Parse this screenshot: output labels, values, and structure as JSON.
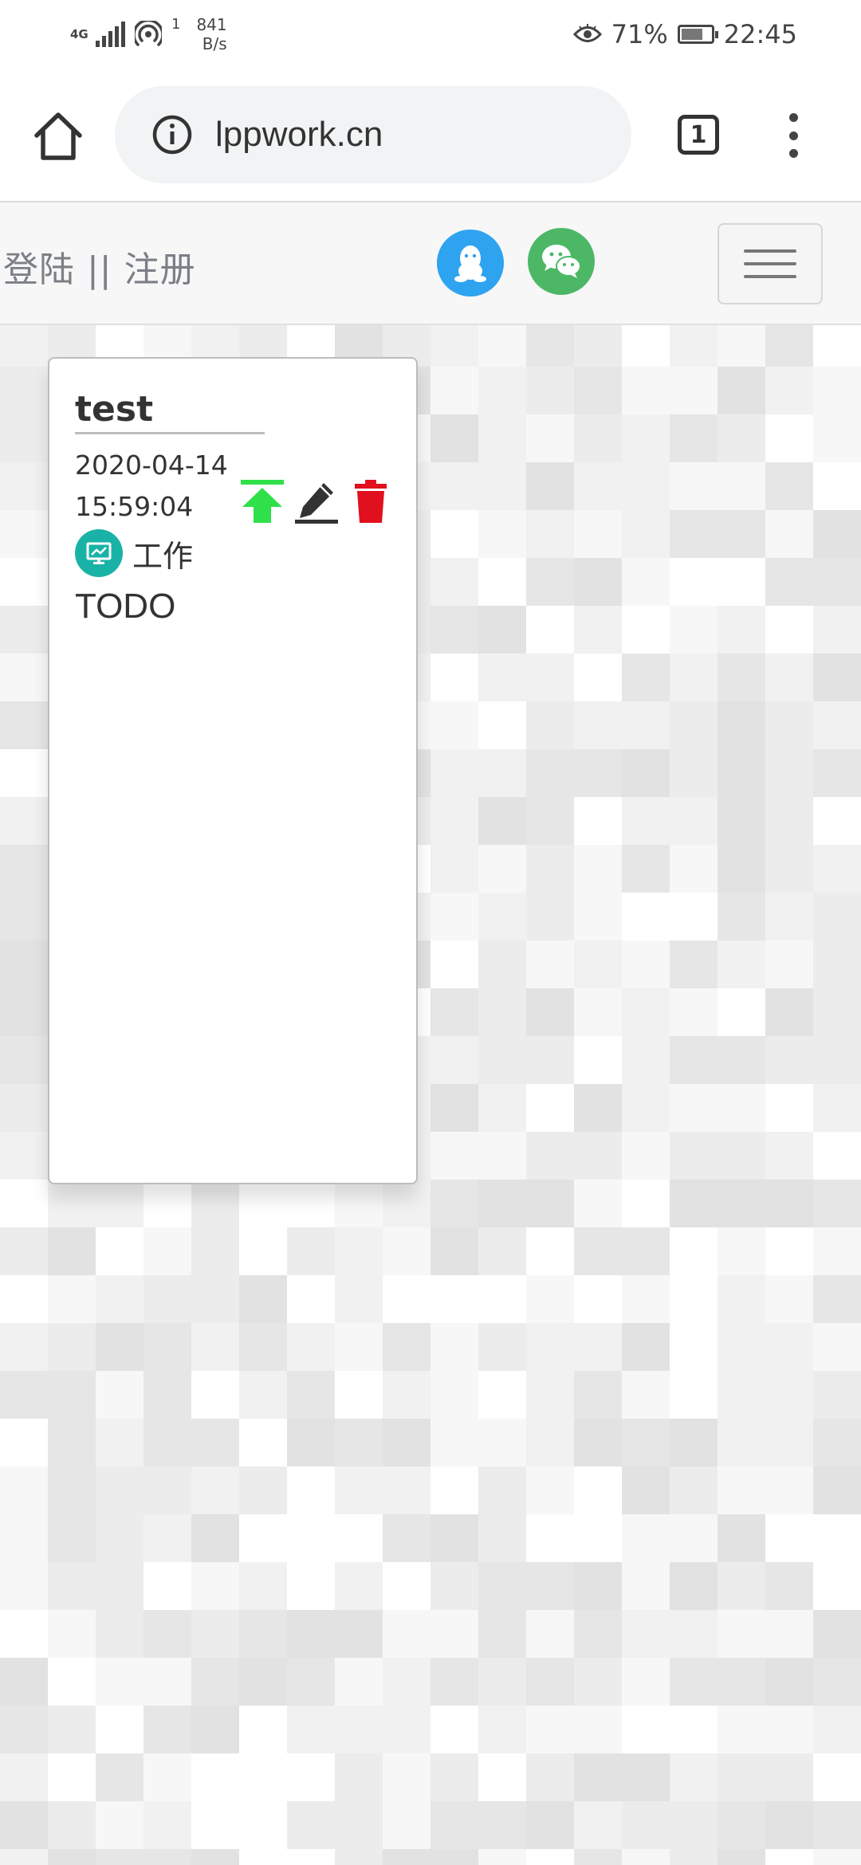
{
  "status_bar": {
    "network_type": "4G",
    "speed_value": "841",
    "speed_unit": "B/s",
    "wifi_count": "1",
    "battery_percent": "71%",
    "time": "22:45",
    "battery_level": 0.71
  },
  "browser": {
    "url": "lppwork.cn",
    "tab_count": "1"
  },
  "site_nav": {
    "login_register": "登陆 || 注册"
  },
  "card": {
    "title": "test",
    "date": "2020-04-14",
    "time": "15:59:04",
    "category": "工作",
    "content": "TODO",
    "action_colors": {
      "top": "#2fe04a",
      "edit": "#333333",
      "delete": "#e0101e"
    }
  },
  "colors": {
    "qq": "#2ea3f0",
    "wechat": "#4cb866",
    "category_icon": "#18b3a6"
  }
}
